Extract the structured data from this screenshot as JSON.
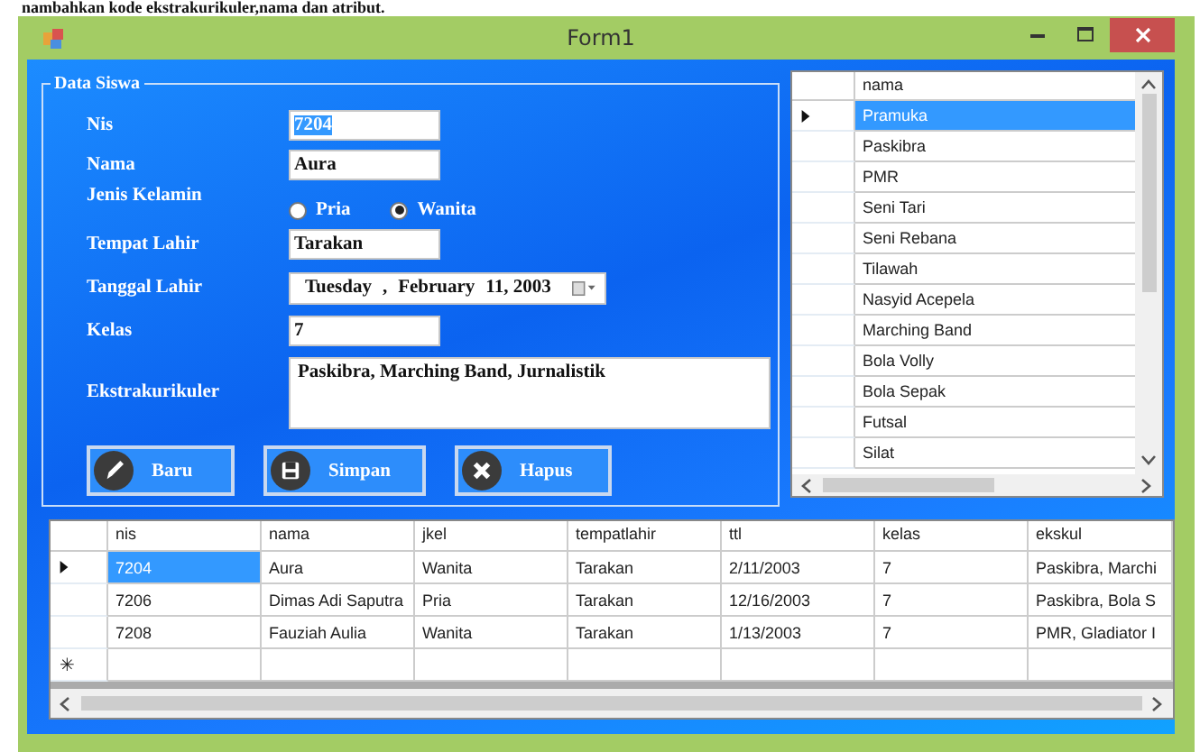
{
  "caption": "nambahkan kode ekstrakurikuler,nama dan atribut.",
  "window": {
    "title": "Form1"
  },
  "group": {
    "title": "Data Siswa",
    "fields": [
      {
        "kind": "text",
        "label": "Nis",
        "value": "7204",
        "focused": true
      },
      {
        "kind": "text",
        "label": "Nama",
        "value": "Aura",
        "focused": false
      },
      {
        "kind": "radio",
        "label": "Jenis Kelamin",
        "options": [
          {
            "label": "Pria",
            "selected": false
          },
          {
            "label": "Wanita",
            "selected": true
          }
        ]
      },
      {
        "kind": "text",
        "label": "Tempat Lahir",
        "value": "Tarakan",
        "focused": false
      },
      {
        "kind": "date",
        "label": "Tanggal Lahir",
        "weekday": "Tuesday",
        "separator": ",",
        "month": "February",
        "day_year": "11, 2003"
      },
      {
        "kind": "text",
        "label": "Kelas",
        "value": "7",
        "focused": false
      },
      {
        "kind": "memo",
        "label": "Ekstrakurikuler",
        "value": "Paskibra, Marching Band, Jurnalistik"
      }
    ],
    "buttons": [
      {
        "label": "Baru",
        "kind": "pencil"
      },
      {
        "label": "Simpan",
        "kind": "save"
      },
      {
        "label": "Hapus",
        "kind": "close"
      }
    ]
  },
  "list_grid": {
    "column": "nama",
    "rows": [
      {
        "text": "Pramuka",
        "selected": true
      },
      {
        "text": "Paskibra",
        "selected": false
      },
      {
        "text": "PMR",
        "selected": false
      },
      {
        "text": "Seni Tari",
        "selected": false
      },
      {
        "text": "Seni Rebana",
        "selected": false
      },
      {
        "text": "Tilawah",
        "selected": false
      },
      {
        "text": "Nasyid Acepela",
        "selected": false
      },
      {
        "text": "Marching Band",
        "selected": false
      },
      {
        "text": "Bola Volly",
        "selected": false
      },
      {
        "text": "Bola Sepak",
        "selected": false
      },
      {
        "text": "Futsal",
        "selected": false
      },
      {
        "text": "Silat",
        "selected": false
      }
    ]
  },
  "main_grid": {
    "columns": [
      "nis",
      "nama",
      "jkel",
      "tempatlahir",
      "ttl",
      "kelas",
      "ekskul"
    ],
    "new_row_marker": "✳",
    "rows": [
      {
        "current": true,
        "cells": [
          {
            "text": "7204",
            "selected": true
          },
          {
            "text": "Aura",
            "selected": false
          },
          {
            "text": "Wanita",
            "selected": false
          },
          {
            "text": "Tarakan",
            "selected": false
          },
          {
            "text": "2/11/2003",
            "selected": false
          },
          {
            "text": "7",
            "selected": false
          },
          {
            "text": "Paskibra, Marchi",
            "selected": false
          }
        ]
      },
      {
        "current": false,
        "cells": [
          {
            "text": "7206",
            "selected": false
          },
          {
            "text": "Dimas Adi Saputra",
            "selected": false
          },
          {
            "text": "Pria",
            "selected": false
          },
          {
            "text": "Tarakan",
            "selected": false
          },
          {
            "text": "12/16/2003",
            "selected": false
          },
          {
            "text": "7",
            "selected": false
          },
          {
            "text": "Paskibra, Bola S",
            "selected": false
          }
        ]
      },
      {
        "current": false,
        "cells": [
          {
            "text": "7208",
            "selected": false
          },
          {
            "text": "Fauziah Aulia",
            "selected": false
          },
          {
            "text": "Wanita",
            "selected": false
          },
          {
            "text": "Tarakan",
            "selected": false
          },
          {
            "text": "1/13/2003",
            "selected": false
          },
          {
            "text": "7",
            "selected": false
          },
          {
            "text": "PMR, Gladiator I",
            "selected": false
          }
        ]
      }
    ]
  }
}
